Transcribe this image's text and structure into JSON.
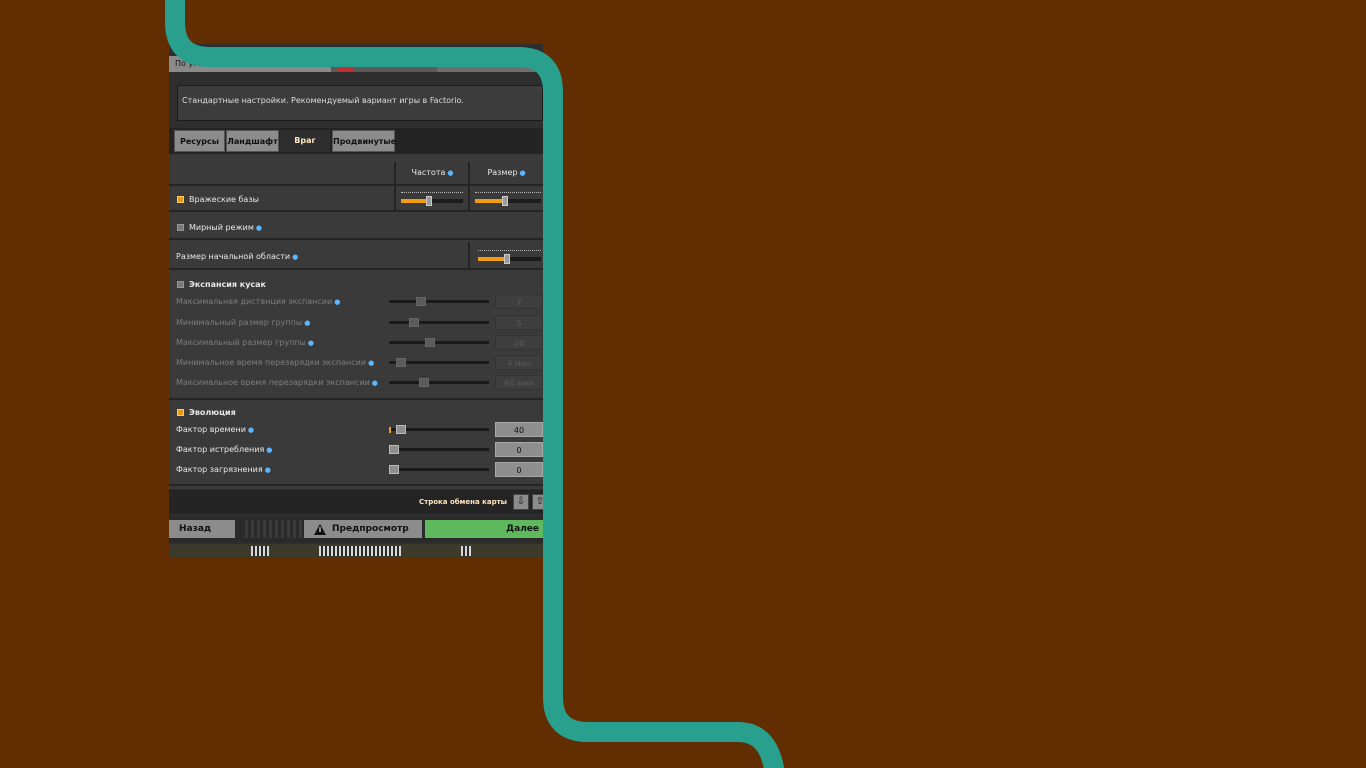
{
  "colors": {
    "background": "#622d00",
    "ribbon": "#29a08e",
    "panel": "#2e2e2e",
    "slider_fill": "#f29c10",
    "next_button": "#5eb85e",
    "info_icon": "#5ab6ff"
  },
  "preset": {
    "selected": "По умо",
    "description": "Стандартные настройки. Рекомендуемый вариант игры в Factorio."
  },
  "tabs": [
    {
      "label": "Ресурсы",
      "active": false
    },
    {
      "label": "Ландшафт",
      "active": false
    },
    {
      "label": "Враг",
      "active": true
    },
    {
      "label": "Продвинутые",
      "active": false
    }
  ],
  "columns": {
    "frequency": "Частота",
    "size": "Размер"
  },
  "enemy_bases": {
    "label": "Вражеские базы",
    "checked": true,
    "frequency_level": 0.45,
    "size_level": 0.45
  },
  "peaceful_mode": {
    "label": "Мирный режим",
    "checked": false
  },
  "starting_area": {
    "label": "Размер начальной области",
    "level": 0.45
  },
  "expansion": {
    "label": "Экспансия кусак",
    "checked": false,
    "items": [
      {
        "label": "Максимальная дистанция экспансии",
        "value": "7",
        "level": 0.3
      },
      {
        "label": "Минимальный размер группы",
        "value": "5",
        "level": 0.22
      },
      {
        "label": "Максимальный размер группы",
        "value": "20",
        "level": 0.4
      },
      {
        "label": "Минимальное время перезарядки экспансии",
        "value": "4 мин",
        "level": 0.08
      },
      {
        "label": "Максимальное время перезарядки экспансии",
        "value": "60 мин",
        "level": 0.33
      }
    ]
  },
  "evolution": {
    "label": "Эволюция",
    "checked": true,
    "items": [
      {
        "label": "Фактор времени",
        "value": "40",
        "level": 0.08
      },
      {
        "label": "Фактор истребления",
        "value": "0",
        "level": 0.0
      },
      {
        "label": "Фактор загрязнения",
        "value": "0",
        "level": 0.0
      }
    ]
  },
  "map_exchange": {
    "label": "Строка обмена карты"
  },
  "footer": {
    "back": "Назад",
    "preview": "Предпросмотр",
    "next": "Далее"
  }
}
